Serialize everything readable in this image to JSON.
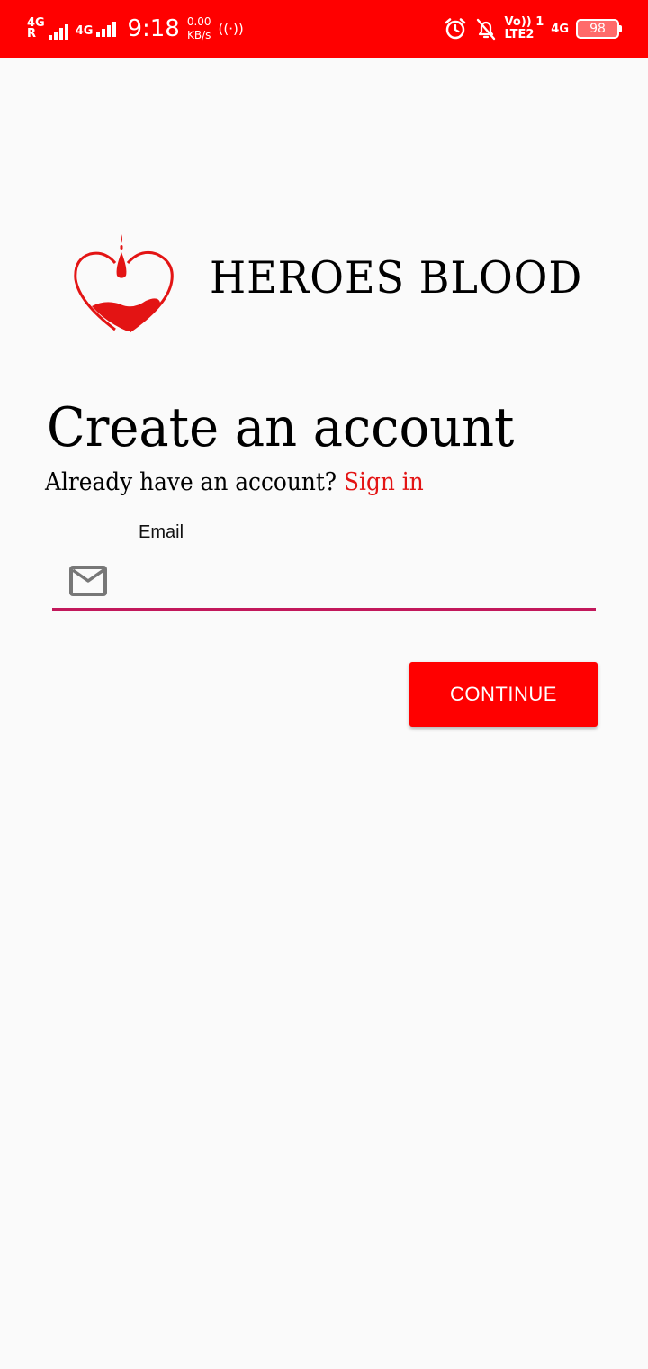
{
  "status_bar": {
    "net1_type": "4G",
    "net1_roaming": "R",
    "net2_type": "4G",
    "time": "9:18",
    "speed_value": "0.00",
    "speed_unit": "KB/s",
    "hotspot_glyph": "((·))",
    "volte_top": "Vo)) 1",
    "volte_bottom": "LTE2",
    "data_type": "4G",
    "battery_level": "98",
    "icons": [
      "signal-icon",
      "signal-icon",
      "hotspot-icon",
      "alarm-icon",
      "bell-off-icon",
      "battery-icon"
    ]
  },
  "brand": {
    "name": "HEROES BLOOD",
    "logo_icon": "heart-blood-drop-icon",
    "logo_color": "#e31414"
  },
  "page": {
    "title": "Create an account",
    "subtitle_text": "Already have an account?",
    "signin_link": "Sign in"
  },
  "form": {
    "email_label": "Email",
    "email_value": "",
    "email_icon": "mail-icon",
    "continue_label": "CONTINUE"
  },
  "colors": {
    "status_bar": "#ff0000",
    "accent": "#ff0000",
    "link": "#e31414",
    "input_underline": "#c2185b",
    "background": "#fafafa"
  }
}
